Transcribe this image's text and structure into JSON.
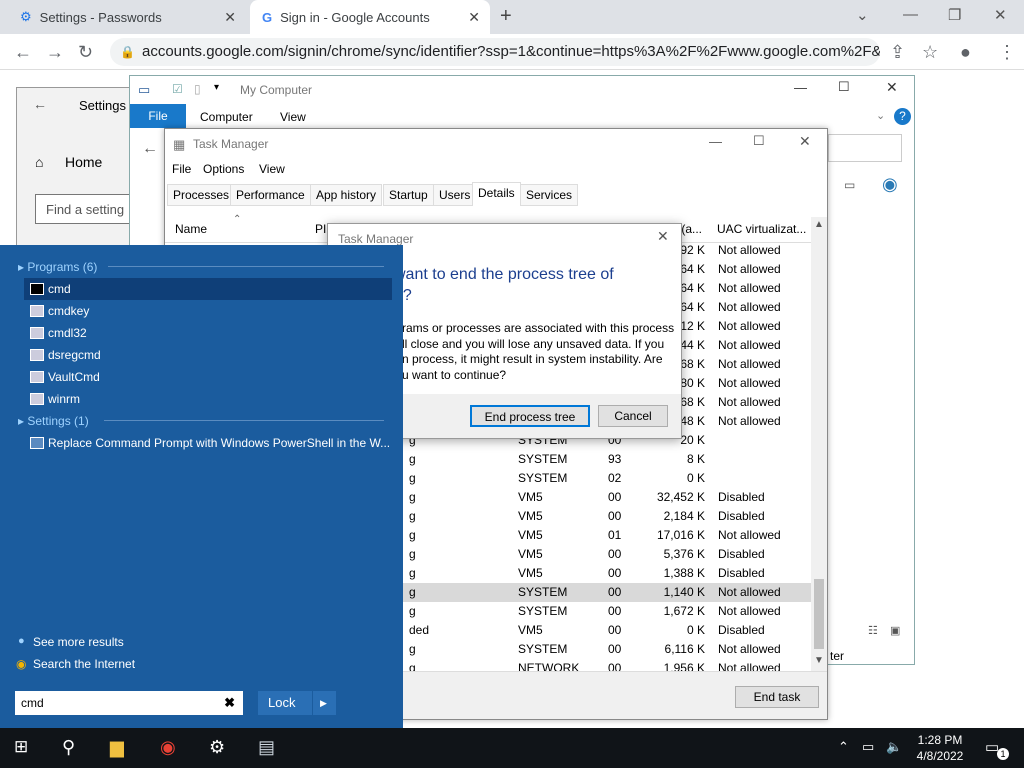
{
  "chrome": {
    "tabs": [
      {
        "title": "Settings - Passwords"
      },
      {
        "title": "Sign in - Google Accounts"
      }
    ],
    "url": "accounts.google.com/signin/chrome/sync/identifier?ssp=1&continue=https%3A%2F%2Fwww.google.com%2F&flow..."
  },
  "settings": {
    "title": "Settings",
    "home": "Home",
    "search_placeholder": "Find a setting"
  },
  "mycomputer": {
    "title": "My Computer",
    "menu": [
      "File",
      "Computer",
      "View"
    ]
  },
  "taskmgr": {
    "title": "Task Manager",
    "menu": [
      "File",
      "Options",
      "View"
    ],
    "tabs": [
      "Processes",
      "Performance",
      "App history",
      "Startup",
      "Users",
      "Details",
      "Services"
    ],
    "columns": {
      "name": "Name",
      "pid": "PID",
      "mem": "y (a...",
      "uac": "UAC virtualizat..."
    },
    "rows": [
      {
        "s": "",
        "user": "",
        "cpu": "",
        "mem": "92 K",
        "uac": "Not allowed"
      },
      {
        "s": "",
        "user": "",
        "cpu": "",
        "mem": "64 K",
        "uac": "Not allowed"
      },
      {
        "s": "",
        "user": "",
        "cpu": "",
        "mem": "64 K",
        "uac": "Not allowed"
      },
      {
        "s": "",
        "user": "",
        "cpu": "",
        "mem": "64 K",
        "uac": "Not allowed"
      },
      {
        "s": "",
        "user": "",
        "cpu": "",
        "mem": "12 K",
        "uac": "Not allowed"
      },
      {
        "s": "",
        "user": "",
        "cpu": "",
        "mem": "44 K",
        "uac": "Not allowed"
      },
      {
        "s": "",
        "user": "",
        "cpu": "",
        "mem": "68 K",
        "uac": "Not allowed"
      },
      {
        "s": "",
        "user": "",
        "cpu": "",
        "mem": "80 K",
        "uac": "Not allowed"
      },
      {
        "s": "",
        "user": "",
        "cpu": "",
        "mem": "68 K",
        "uac": "Not allowed"
      },
      {
        "s": "",
        "user": "",
        "cpu": "",
        "mem": "48 K",
        "uac": "Not allowed"
      },
      {
        "s": "g",
        "user": "SYSTEM",
        "cpu": "00",
        "mem": "20 K",
        "uac": ""
      },
      {
        "s": "g",
        "user": "SYSTEM",
        "cpu": "93",
        "mem": "8 K",
        "uac": ""
      },
      {
        "s": "g",
        "user": "SYSTEM",
        "cpu": "02",
        "mem": "0 K",
        "uac": ""
      },
      {
        "s": "g",
        "user": "VM5",
        "cpu": "00",
        "mem": "32,452 K",
        "uac": "Disabled"
      },
      {
        "s": "g",
        "user": "VM5",
        "cpu": "00",
        "mem": "2,184 K",
        "uac": "Disabled"
      },
      {
        "s": "g",
        "user": "VM5",
        "cpu": "01",
        "mem": "17,016 K",
        "uac": "Not allowed"
      },
      {
        "s": "g",
        "user": "VM5",
        "cpu": "00",
        "mem": "5,376 K",
        "uac": "Disabled"
      },
      {
        "s": "g",
        "user": "VM5",
        "cpu": "00",
        "mem": "1,388 K",
        "uac": "Disabled"
      },
      {
        "s": "g",
        "user": "SYSTEM",
        "cpu": "00",
        "mem": "1,140 K",
        "uac": "Not allowed"
      },
      {
        "s": "g",
        "user": "SYSTEM",
        "cpu": "00",
        "mem": "1,672 K",
        "uac": "Not allowed"
      },
      {
        "s": "ded",
        "user": "VM5",
        "cpu": "00",
        "mem": "0 K",
        "uac": "Disabled"
      },
      {
        "s": "g",
        "user": "SYSTEM",
        "cpu": "00",
        "mem": "6,116 K",
        "uac": "Not allowed"
      },
      {
        "s": "g",
        "user": "NETWORK",
        "cpu": "00",
        "mem": "1,956 K",
        "uac": "Not allowed"
      }
    ],
    "end_task": "End task",
    "side_text": "ter"
  },
  "dialog": {
    "title": "Task Manager",
    "heading1": "want to end the process tree of",
    "heading2": "e?",
    "body1": "rams or processes are associated with this process",
    "body2": "ll close and you will lose any unsaved data. If you",
    "body3": "n process, it might result in system instability. Are",
    "body4": "u want to continue?",
    "ok": "End process tree",
    "cancel": "Cancel"
  },
  "startmenu": {
    "programs_header": "Programs (6)",
    "programs": [
      "cmd",
      "cmdkey",
      "cmdl32",
      "dsregcmd",
      "VaultCmd",
      "winrm"
    ],
    "settings_header": "Settings (1)",
    "settings_item": "Replace Command Prompt with Windows PowerShell in the W...",
    "see_more": "See more results",
    "search_internet": "Search the Internet",
    "search_value": "cmd",
    "lock": "Lock"
  },
  "taskbar": {
    "time": "1:28 PM",
    "date": "4/8/2022",
    "notif_count": "1"
  }
}
